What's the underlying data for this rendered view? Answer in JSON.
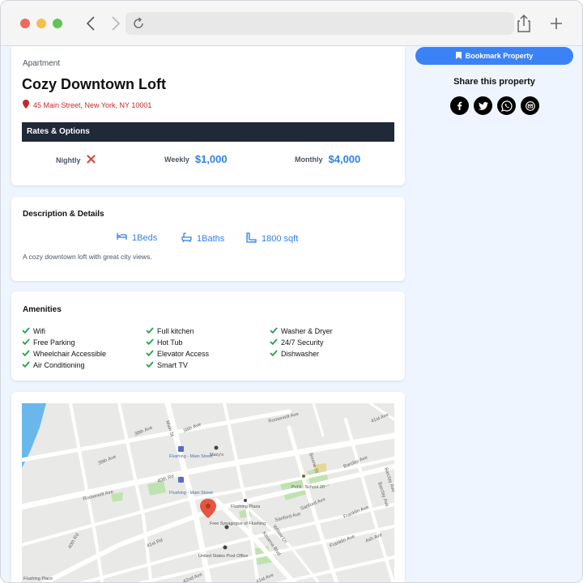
{
  "browser": {
    "url_placeholder": "",
    "icons": [
      "chevron-left-icon",
      "chevron-right-icon",
      "reload-icon",
      "share-icon",
      "plus-icon"
    ]
  },
  "property": {
    "type": "Apartment",
    "title": "Cozy Downtown Loft",
    "address": "45 Main Street, New York, NY 10001",
    "address_color": "#c62828"
  },
  "rates": {
    "header": "Rates & Options",
    "nightly_label": "Nightly",
    "weekly_label": "Weekly",
    "weekly_value": "$1,000",
    "monthly_label": "Monthly",
    "monthly_value": "$4,000",
    "accent_color": "#2f80ed"
  },
  "description": {
    "title": "Description & Details",
    "beds": "1Beds",
    "baths": "1Baths",
    "sqft": "1800 sqft",
    "text": "A cozy downtown loft with great city views."
  },
  "amenities": {
    "title": "Amenities",
    "items": [
      "Wifi",
      "Full kitchen",
      "Washer & Dryer",
      "Free Parking",
      "Hot Tub",
      "24/7 Security",
      "Wheelchair Accessible",
      "Elevator Access",
      "Dishwasher",
      "Air Conditioning",
      "Smart TV"
    ],
    "check_color": "#22a04b"
  },
  "map": {
    "streets": {
      "s38": "38th Ave",
      "main": "Main St",
      "s39": "39th Ave",
      "roosevelt_top": "Roosevelt Ave",
      "s41": "41st Ave",
      "s40": "40th Rd",
      "roosevelt_left": "Roosevelt Ave",
      "bowne": "Bowne St",
      "barclay": "Barclay Ave",
      "sanford": "Sanford Ave",
      "franklin": "Franklin Ave",
      "kissena": "Kissena Blvd",
      "willow": "Willow Ln",
      "ash": "Ash Ave",
      "s41rd": "41st Rd",
      "s40left": "40th Rd",
      "s42": "42nd Ave",
      "s41b": "41st Ave"
    },
    "places": {
      "station1": "Flushing - Main Street",
      "station2": "Flushing - Main Street",
      "macys": "Macy's",
      "school": "Public School 20",
      "plaza": "Flushing Plaza",
      "synagogue": "Free Synagogue of Flushing",
      "postoffice": "United States Post Office",
      "corner": "Flushing Place"
    }
  },
  "sidebar": {
    "bookmark_label": "Bookmark Property",
    "share_title": "Share this property",
    "share_icons": [
      "facebook-icon",
      "twitter-icon",
      "whatsapp-icon",
      "email-icon"
    ],
    "button_color": "#3b82f6"
  }
}
